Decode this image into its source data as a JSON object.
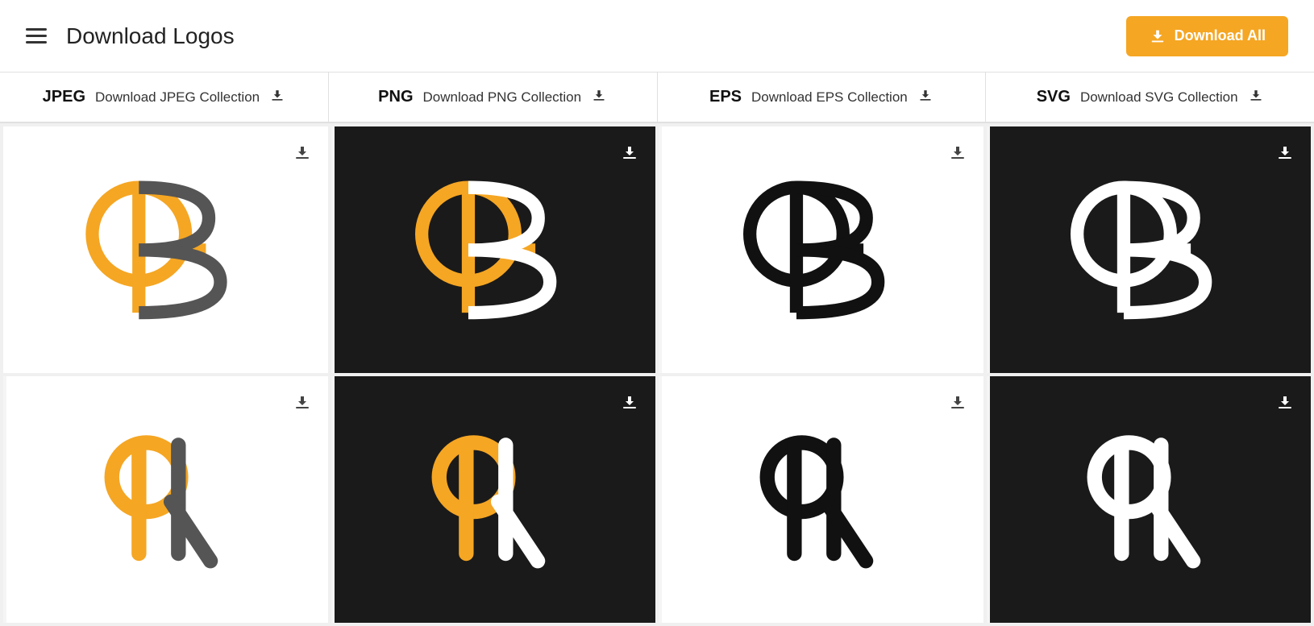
{
  "header": {
    "title": "Download Logos",
    "download_all_label": "Download All"
  },
  "collection_bar": {
    "items": [
      {
        "label": "JPEG",
        "link_text": "Download JPEG Collection"
      },
      {
        "label": "PNG",
        "link_text": "Download PNG Collection"
      },
      {
        "label": "EPS",
        "link_text": "Download EPS Collection"
      },
      {
        "label": "SVG",
        "link_text": "Download SVG Collection"
      }
    ]
  },
  "grid": {
    "rows": [
      {
        "cells": [
          {
            "bg": "light",
            "logo_variant": "color-on-white"
          },
          {
            "bg": "dark",
            "logo_variant": "color-on-dark"
          },
          {
            "bg": "light",
            "logo_variant": "bw-on-white"
          },
          {
            "bg": "dark",
            "logo_variant": "bw-on-dark"
          }
        ]
      },
      {
        "cells": [
          {
            "bg": "light",
            "logo_variant": "color-r-on-white"
          },
          {
            "bg": "dark",
            "logo_variant": "color-r-on-dark"
          },
          {
            "bg": "light",
            "logo_variant": "bw-r-on-white"
          },
          {
            "bg": "dark",
            "logo_variant": "bw-r-on-dark"
          }
        ]
      }
    ]
  },
  "colors": {
    "orange": "#f5a623",
    "dark_bg": "#1a1a1a",
    "gray_logo": "#555",
    "accent": "#f5a623"
  }
}
